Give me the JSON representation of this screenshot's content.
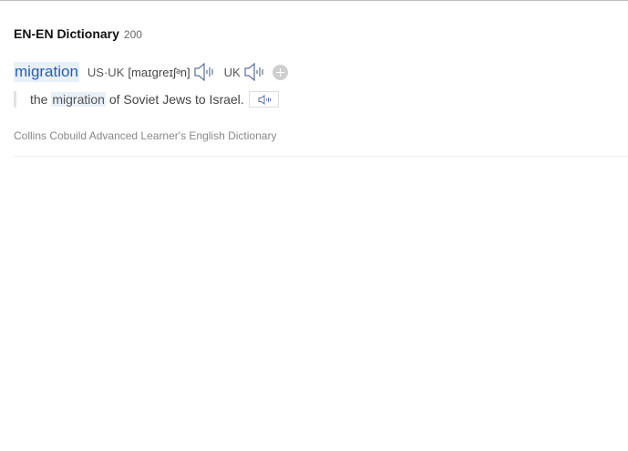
{
  "dictionary": {
    "title": "EN-EN Dictionary",
    "count": "200",
    "source": "Collins Cobuild Advanced Learner's English Dictionary"
  },
  "entry": {
    "headword": "migration",
    "pronunciations": [
      {
        "label": "US·UK",
        "phonetic": "[maɪɡreɪʃᵊn]",
        "icon": "speaker-icon"
      },
      {
        "label": "UK",
        "phonetic": "",
        "icon": "speaker-icon"
      }
    ],
    "more_icon": "plus-icon"
  },
  "example": {
    "before": "the ",
    "highlight": "migration",
    "after": " of Soviet Jews to Israel.",
    "icon": "speaker-icon"
  },
  "colors": {
    "headword": "#2a5db0",
    "highlight_bg": "#e8f0f8",
    "speaker": "#5b6fa0"
  }
}
